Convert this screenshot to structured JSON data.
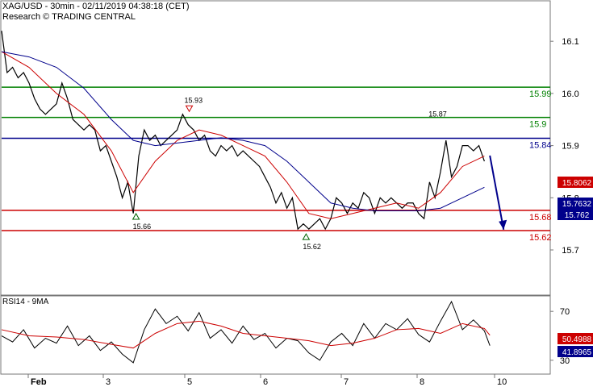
{
  "header": {
    "line1": "XAG/USD - 30min - 02/11/2019 04:38:18 (CET)",
    "line2": "Research © TRADING CENTRAL"
  },
  "subchart": {
    "label": "RSI14 - 9MA"
  },
  "chart_data": [
    {
      "type": "line",
      "title": "XAG/USD - 30min - 02/11/2019 04:38:18 (CET)",
      "ylim": [
        15.615,
        16.125
      ],
      "y_ticks": [
        "16.1",
        "16.0",
        "15.9",
        "15.8",
        "15.7"
      ],
      "x_ticks": [
        "Feb",
        "3",
        "5",
        "6",
        "7",
        "8",
        "10"
      ],
      "levels": [
        {
          "label": "15.99",
          "value": 16.012,
          "color": "#008000"
        },
        {
          "label": "15.9",
          "value": 15.954,
          "color": "#008000"
        },
        {
          "label": "15.84",
          "value": 15.914,
          "color": "#00008b"
        },
        {
          "label": "15.68",
          "value": 15.776,
          "color": "#cc0000"
        },
        {
          "label": "15.62",
          "value": 15.737,
          "color": "#cc0000"
        }
      ],
      "price_tags": [
        {
          "label": "15.8062",
          "value": 15.8062,
          "color": "#cc0000"
        },
        {
          "label": "15.7632",
          "value": 15.7632,
          "color": "#00008b"
        },
        {
          "label": "15.762",
          "value": 15.762,
          "color": "#00008b"
        }
      ],
      "annotations": [
        {
          "label": "15.93",
          "marker": "down-triangle",
          "x": 0.342,
          "value": 15.97
        },
        {
          "label": "15.87",
          "marker": "none",
          "x": 0.79,
          "value": 15.956
        },
        {
          "label": "15.66",
          "marker": "up-triangle",
          "x": 0.245,
          "value": 15.765
        },
        {
          "label": "15.62",
          "marker": "up-triangle",
          "x": 0.555,
          "value": 15.726
        }
      ],
      "forecast_arrow": {
        "from": [
          0.89,
          15.881
        ],
        "to": [
          0.915,
          15.739
        ],
        "color": "#00008b"
      },
      "series": [
        {
          "color": "#000000",
          "x": [
            0,
            0.01,
            0.02,
            0.03,
            0.04,
            0.05,
            0.06,
            0.07,
            0.08,
            0.09,
            0.1,
            0.11,
            0.12,
            0.13,
            0.14,
            0.15,
            0.16,
            0.17,
            0.18,
            0.19,
            0.2,
            0.21,
            0.22,
            0.23,
            0.24,
            0.25,
            0.26,
            0.27,
            0.28,
            0.29,
            0.3,
            0.31,
            0.32,
            0.33,
            0.34,
            0.35,
            0.36,
            0.37,
            0.38,
            0.39,
            0.4,
            0.41,
            0.42,
            0.43,
            0.44,
            0.45,
            0.46,
            0.47,
            0.48,
            0.49,
            0.5,
            0.51,
            0.52,
            0.53,
            0.54,
            0.55,
            0.56,
            0.57,
            0.58,
            0.59,
            0.6,
            0.61,
            0.62,
            0.63,
            0.64,
            0.65,
            0.66,
            0.67,
            0.68,
            0.69,
            0.7,
            0.71,
            0.72,
            0.73,
            0.74,
            0.75,
            0.76,
            0.77,
            0.78,
            0.79,
            0.8,
            0.81,
            0.82,
            0.83,
            0.84,
            0.85,
            0.86,
            0.87,
            0.88
          ],
          "values": [
            16.12,
            16.04,
            16.05,
            16.03,
            16.04,
            16.02,
            15.99,
            15.97,
            15.96,
            15.97,
            15.98,
            16.02,
            15.99,
            15.95,
            15.94,
            15.93,
            15.94,
            15.93,
            15.89,
            15.9,
            15.87,
            15.84,
            15.8,
            15.83,
            15.77,
            15.88,
            15.93,
            15.91,
            15.92,
            15.9,
            15.91,
            15.92,
            15.93,
            15.96,
            15.94,
            15.93,
            15.91,
            15.92,
            15.89,
            15.88,
            15.9,
            15.89,
            15.9,
            15.88,
            15.89,
            15.88,
            15.87,
            15.86,
            15.84,
            15.82,
            15.79,
            15.81,
            15.78,
            15.8,
            15.74,
            15.75,
            15.74,
            15.75,
            15.76,
            15.74,
            15.76,
            15.8,
            15.79,
            15.77,
            15.79,
            15.78,
            15.81,
            15.8,
            15.77,
            15.8,
            15.79,
            15.8,
            15.79,
            15.78,
            15.79,
            15.79,
            15.77,
            15.76,
            15.83,
            15.8,
            15.85,
            15.91,
            15.84,
            15.86,
            15.9,
            15.9,
            15.89,
            15.9,
            15.87
          ]
        },
        {
          "color": "#cc0000",
          "x": [
            0,
            0.05,
            0.1,
            0.15,
            0.2,
            0.24,
            0.28,
            0.32,
            0.36,
            0.4,
            0.44,
            0.48,
            0.52,
            0.56,
            0.6,
            0.64,
            0.68,
            0.72,
            0.76,
            0.8,
            0.84,
            0.88
          ],
          "values": [
            16.08,
            16.05,
            16.0,
            15.96,
            15.89,
            15.81,
            15.87,
            15.91,
            15.93,
            15.92,
            15.9,
            15.88,
            15.83,
            15.77,
            15.76,
            15.77,
            15.78,
            15.79,
            15.78,
            15.81,
            15.86,
            15.88
          ]
        },
        {
          "color": "#00008b",
          "x": [
            0,
            0.05,
            0.1,
            0.15,
            0.2,
            0.24,
            0.28,
            0.32,
            0.36,
            0.4,
            0.44,
            0.48,
            0.52,
            0.56,
            0.6,
            0.64,
            0.68,
            0.72,
            0.76,
            0.8,
            0.84,
            0.88
          ],
          "values": [
            16.08,
            16.07,
            16.05,
            16.01,
            15.95,
            15.91,
            15.9,
            15.905,
            15.91,
            15.915,
            15.91,
            15.9,
            15.87,
            15.83,
            15.79,
            15.78,
            15.775,
            15.775,
            15.775,
            15.78,
            15.8,
            15.82
          ]
        }
      ]
    },
    {
      "type": "line",
      "title": "RSI14 - 9MA",
      "ylim": [
        20,
        82
      ],
      "y_ticks": [
        "70",
        "30"
      ],
      "price_tags": [
        {
          "label": "50.4988",
          "value": 50.4988,
          "color": "#cc0000"
        },
        {
          "label": "41.8965",
          "value": 41.8965,
          "color": "#00008b"
        }
      ],
      "series": [
        {
          "color": "#000000",
          "x": [
            0,
            0.02,
            0.04,
            0.06,
            0.08,
            0.1,
            0.12,
            0.14,
            0.16,
            0.18,
            0.2,
            0.22,
            0.24,
            0.26,
            0.28,
            0.3,
            0.32,
            0.34,
            0.36,
            0.38,
            0.4,
            0.42,
            0.44,
            0.46,
            0.48,
            0.5,
            0.52,
            0.54,
            0.56,
            0.58,
            0.6,
            0.62,
            0.64,
            0.66,
            0.68,
            0.7,
            0.72,
            0.74,
            0.76,
            0.78,
            0.8,
            0.82,
            0.84,
            0.86,
            0.88,
            0.89
          ],
          "values": [
            50,
            45,
            55,
            40,
            48,
            44,
            58,
            42,
            50,
            38,
            45,
            35,
            28,
            55,
            72,
            60,
            66,
            54,
            69,
            48,
            55,
            44,
            58,
            47,
            52,
            40,
            48,
            46,
            36,
            30,
            45,
            52,
            42,
            60,
            48,
            60,
            55,
            64,
            51,
            45,
            62,
            78,
            55,
            63,
            54,
            42
          ]
        },
        {
          "color": "#cc0000",
          "x": [
            0,
            0.05,
            0.1,
            0.15,
            0.2,
            0.24,
            0.28,
            0.32,
            0.36,
            0.4,
            0.44,
            0.48,
            0.52,
            0.56,
            0.6,
            0.64,
            0.68,
            0.72,
            0.76,
            0.8,
            0.84,
            0.88,
            0.89
          ],
          "values": [
            55,
            50,
            49,
            47,
            43,
            40,
            52,
            60,
            62,
            58,
            52,
            50,
            48,
            46,
            42,
            44,
            48,
            55,
            56,
            52,
            60,
            56,
            50.5
          ]
        }
      ]
    }
  ]
}
